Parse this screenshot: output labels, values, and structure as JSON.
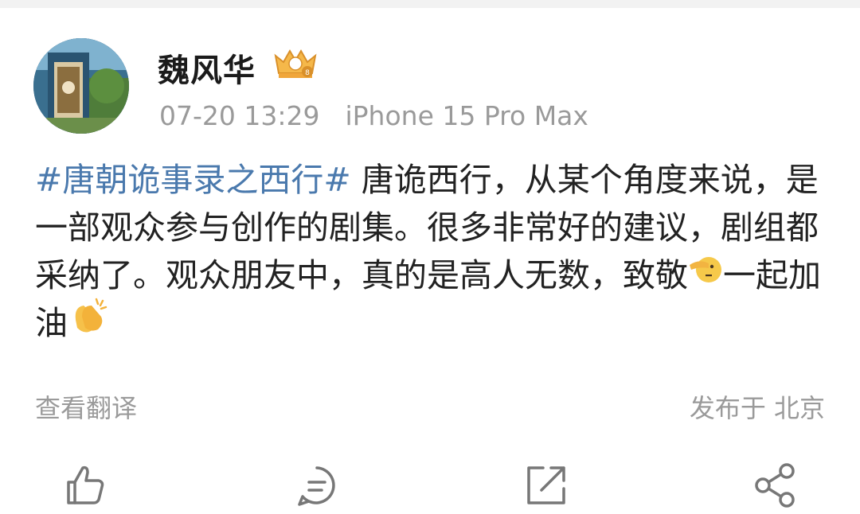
{
  "post": {
    "author": "魏风华",
    "badge_icon": "vip-crown-badge-icon",
    "time": "07-20 13:29",
    "device": "iPhone 15 Pro Max",
    "hashtag": "#唐朝诡事录之西行#",
    "text_part1": " 唐诡西行，从某个角度来说，是一部观众参与创作的剧集。很多非常好的建议，剧组都采纳了。观众朋友中，真的是高人无数，致敬",
    "emoji1": "pointing-face-emoji",
    "text_part2": "一起加油",
    "emoji2": "clapping-hands-emoji",
    "translate_label": "查看翻译",
    "location": "发布于 北京"
  },
  "actions": [
    {
      "name": "like",
      "icon": "thumbs-up-icon"
    },
    {
      "name": "comment",
      "icon": "comment-bubble-icon"
    },
    {
      "name": "repost",
      "icon": "repost-icon"
    },
    {
      "name": "share",
      "icon": "share-icon"
    }
  ],
  "colors": {
    "hashtag": "#4a79ad",
    "meta_text": "#9a9a9a",
    "icon_stroke": "#777777"
  }
}
